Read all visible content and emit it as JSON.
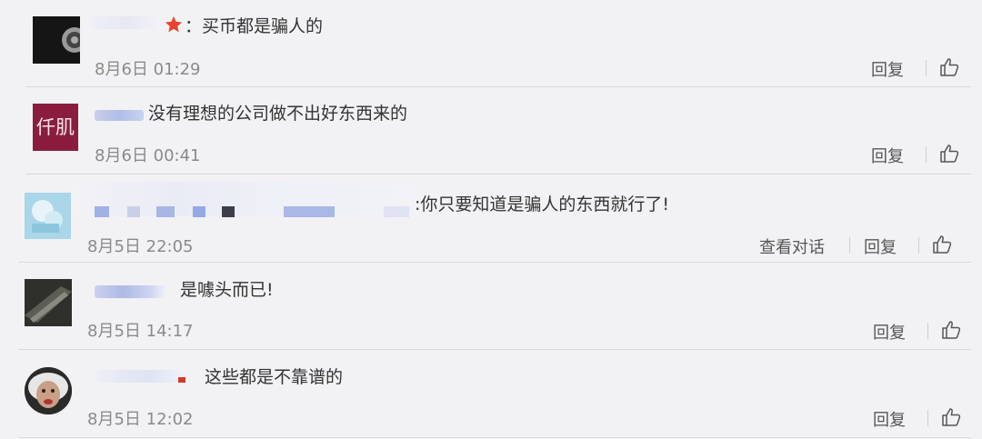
{
  "comments": [
    {
      "text": "：买币都是骗人的",
      "time": "8月6日 01:29",
      "reply": "回复"
    },
    {
      "text": "没有理想的公司做不出好东西来的",
      "time": "8月6日 00:41",
      "reply": "回复",
      "avatar_text": "仟肌"
    },
    {
      "text": ":你只要知道是骗人的东西就行了!",
      "time": "8月5日 22:05",
      "view_conversation": "查看对话",
      "reply": "回复"
    },
    {
      "text": "是噱头而已!",
      "time": "8月5日 14:17",
      "reply": "回复"
    },
    {
      "text": "这些都是不靠谱的",
      "time": "8月5日 12:02",
      "reply": "回复"
    }
  ],
  "colors": {
    "star": "#e8432f",
    "avatar2": "#8a1d3d",
    "background": "#f2f2f5"
  },
  "icons": {
    "like": "thumbs-up-icon",
    "star": "star-icon"
  }
}
